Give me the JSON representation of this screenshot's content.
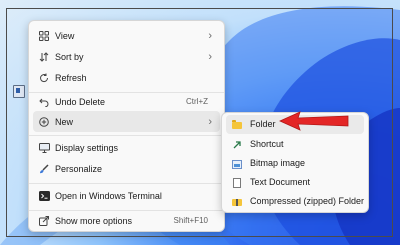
{
  "context_menu": {
    "items": [
      {
        "label": "View",
        "has_submenu": true,
        "icon": "grid-view-icon"
      },
      {
        "label": "Sort by",
        "has_submenu": true,
        "icon": "sort-icon"
      },
      {
        "label": "Refresh",
        "icon": "refresh-icon"
      },
      {
        "label": "Undo Delete",
        "shortcut": "Ctrl+Z",
        "icon": "undo-icon"
      },
      {
        "label": "New",
        "has_submenu": true,
        "icon": "plus-circle-icon"
      },
      {
        "label": "Display settings",
        "icon": "display-icon"
      },
      {
        "label": "Personalize",
        "icon": "brush-icon"
      },
      {
        "label": "Open in Windows Terminal",
        "icon": "terminal-icon"
      },
      {
        "label": "Show more options",
        "shortcut": "Shift+F10",
        "icon": "share-icon"
      }
    ],
    "active_item": "New"
  },
  "new_submenu": {
    "items": [
      {
        "label": "Folder",
        "icon": "folder-icon"
      },
      {
        "label": "Shortcut",
        "icon": "shortcut-icon"
      },
      {
        "label": "Bitmap image",
        "icon": "bitmap-icon"
      },
      {
        "label": "Text Document",
        "icon": "text-document-icon"
      },
      {
        "label": "Compressed (zipped) Folder",
        "icon": "zip-folder-icon"
      }
    ],
    "active_item": "Folder"
  },
  "colors": {
    "menu_background": "#f9f9f9",
    "highlight": "#e8e8e8",
    "pointer_arrow": "#e32626",
    "wallpaper_blue": "#2b64ee"
  }
}
